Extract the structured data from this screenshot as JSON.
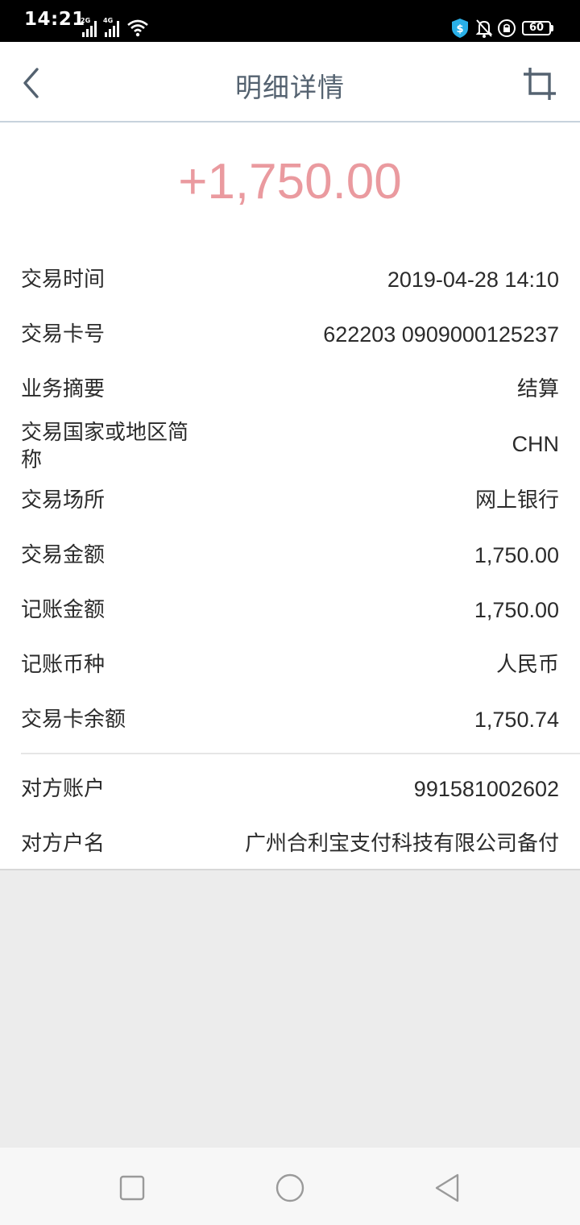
{
  "status_bar": {
    "time": "14:21",
    "signal1_label": "2G",
    "signal2_label": "4G",
    "battery": "60",
    "icons": [
      "signal-icon",
      "signal-icon",
      "wifi-icon",
      "shield-icon",
      "bell-muted-icon",
      "lock-rotation-icon",
      "battery-icon"
    ]
  },
  "header": {
    "title": "明细详情",
    "back_icon": "chevron-left-icon",
    "action_icon": "crop-icon"
  },
  "amount": "+1,750.00",
  "colors": {
    "amount": "#ea9a9f",
    "title": "#546270",
    "text": "#2b2b2b"
  },
  "details": [
    {
      "label": "交易时间",
      "value": "2019-04-28 14:10"
    },
    {
      "label": "交易卡号",
      "value": "622203 0909000125237"
    },
    {
      "label": "业务摘要",
      "value": "结算"
    },
    {
      "label": "交易国家或地区简称",
      "value": "CHN"
    },
    {
      "label": "交易场所",
      "value": "网上银行"
    },
    {
      "label": "交易金额",
      "value": "1,750.00"
    },
    {
      "label": "记账金额",
      "value": "1,750.00"
    },
    {
      "label": "记账币种",
      "value": "人民币"
    },
    {
      "label": "交易卡余额",
      "value": "1,750.74"
    }
  ],
  "counterparty": [
    {
      "label": "对方账户",
      "value": "991581002602"
    },
    {
      "label": "对方户名",
      "value": "广州合利宝支付科技有限公司备付"
    }
  ],
  "system_nav": {
    "icons": [
      "recent-apps-icon",
      "home-icon",
      "back-icon"
    ]
  }
}
